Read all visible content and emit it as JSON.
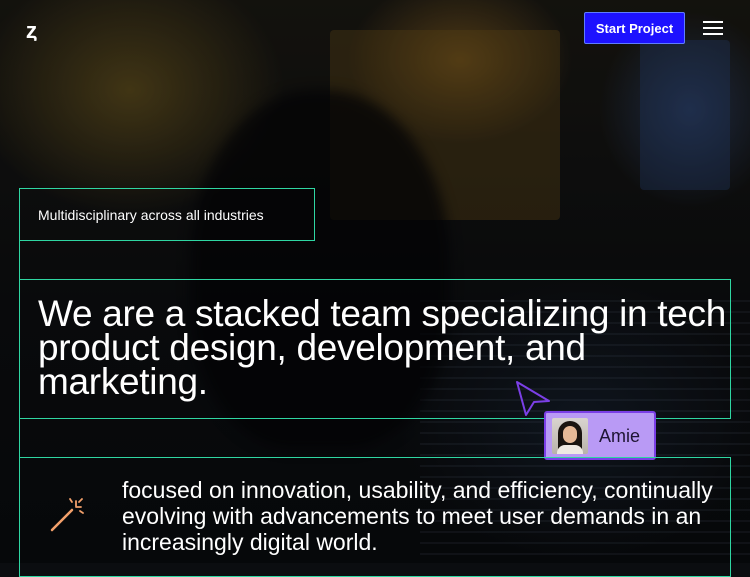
{
  "header": {
    "logo": "ȥ",
    "cta_label": "Start Project"
  },
  "hero": {
    "tagline": "Multidisciplinary across all industries",
    "headline": "We are a stacked team specializing in tech product design, development, and marketing.",
    "subheadline": "focused on innovation, usability, and efficiency, continually evolving with advancements to meet user demands in an increasingly digital world."
  },
  "collaborator": {
    "name": "Amie"
  },
  "icons": {
    "logo": "logo-icon",
    "menu": "hamburger-menu-icon",
    "wand": "magic-wand-icon",
    "cursor": "cursor-arrow-icon"
  },
  "colors": {
    "accent_green": "#2fd6a2",
    "cta_blue": "#1d12ff",
    "badge_purple": "#b99af5",
    "cursor_purple": "#7b3fe6",
    "wand_orange": "#f2a06b"
  }
}
